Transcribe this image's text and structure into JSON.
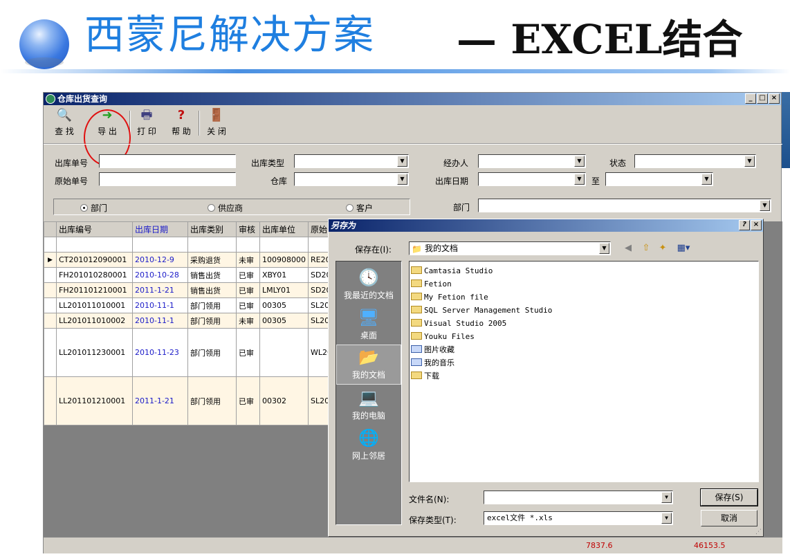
{
  "slide": {
    "title_main": "西蒙尼解决方案",
    "title_sub": "— EXCEL结合"
  },
  "window": {
    "title": "仓库出货查询"
  },
  "toolbar": {
    "find": "查 找",
    "export": "导 出",
    "print": "打 印",
    "help": "帮 助",
    "close": "关 闭"
  },
  "filters": {
    "out_no_label": "出库单号",
    "out_type_label": "出库类型",
    "handler_label": "经办人",
    "status_label": "状态",
    "orig_no_label": "原始单号",
    "warehouse_label": "仓库",
    "out_date_label": "出库日期",
    "to_label": "至",
    "dept_label": "部门",
    "radio_dept": "部门",
    "radio_supplier": "供应商",
    "radio_customer": "客户"
  },
  "grid": {
    "headers": [
      "出库编号",
      "出库日期",
      "出库类别",
      "审核",
      "出库单位",
      "原始"
    ],
    "rows": [
      {
        "no": "CT201012090001",
        "date": "2010-12-9",
        "type": "采购退货",
        "audit": "未审",
        "unit": "100908000",
        "orig": "RE20"
      },
      {
        "no": "FH201010280001",
        "date": "2010-10-28",
        "type": "销售出货",
        "audit": "已审",
        "unit": "XBY01",
        "orig": "SD20"
      },
      {
        "no": "FH201101210001",
        "date": "2011-1-21",
        "type": "销售出货",
        "audit": "已审",
        "unit": "LMLY01",
        "orig": "SD20"
      },
      {
        "no": "LL201011010001",
        "date": "2010-11-1",
        "type": "部门领用",
        "audit": "已审",
        "unit": "00305",
        "orig": "SL20"
      },
      {
        "no": "LL201011010002",
        "date": "2010-11-1",
        "type": "部门领用",
        "audit": "未审",
        "unit": "00305",
        "orig": "SL20"
      },
      {
        "no": "LL201011230001",
        "date": "2010-11-23",
        "type": "部门领用",
        "audit": "已审",
        "unit": "",
        "orig": "WL20"
      },
      {
        "no": "LL201101210001",
        "date": "2011-1-21",
        "type": "部门领用",
        "audit": "已审",
        "unit": "00302",
        "orig": "SL20"
      }
    ]
  },
  "status": {
    "total1": "7837.6",
    "total2": "46153.5"
  },
  "dialog": {
    "title": "另存为",
    "help_btn": "?",
    "close_btn": "×",
    "save_in_label": "保存在(I):",
    "save_in_value": "我的文档",
    "places": [
      "我最近的文档",
      "桌面",
      "我的文档",
      "我的电脑",
      "网上邻居"
    ],
    "files": [
      "Camtasia Studio",
      "Fetion",
      "My Fetion file",
      "SQL Server Management Studio",
      "Visual Studio 2005",
      "Youku Files",
      "图片收藏",
      "我的音乐",
      "下载"
    ],
    "filename_label": "文件名(N):",
    "filename_value": "",
    "filetype_label": "保存类型(T):",
    "filetype_value": "excel文件 *.xls",
    "save_btn": "保存(S)",
    "cancel_btn": "取消"
  }
}
